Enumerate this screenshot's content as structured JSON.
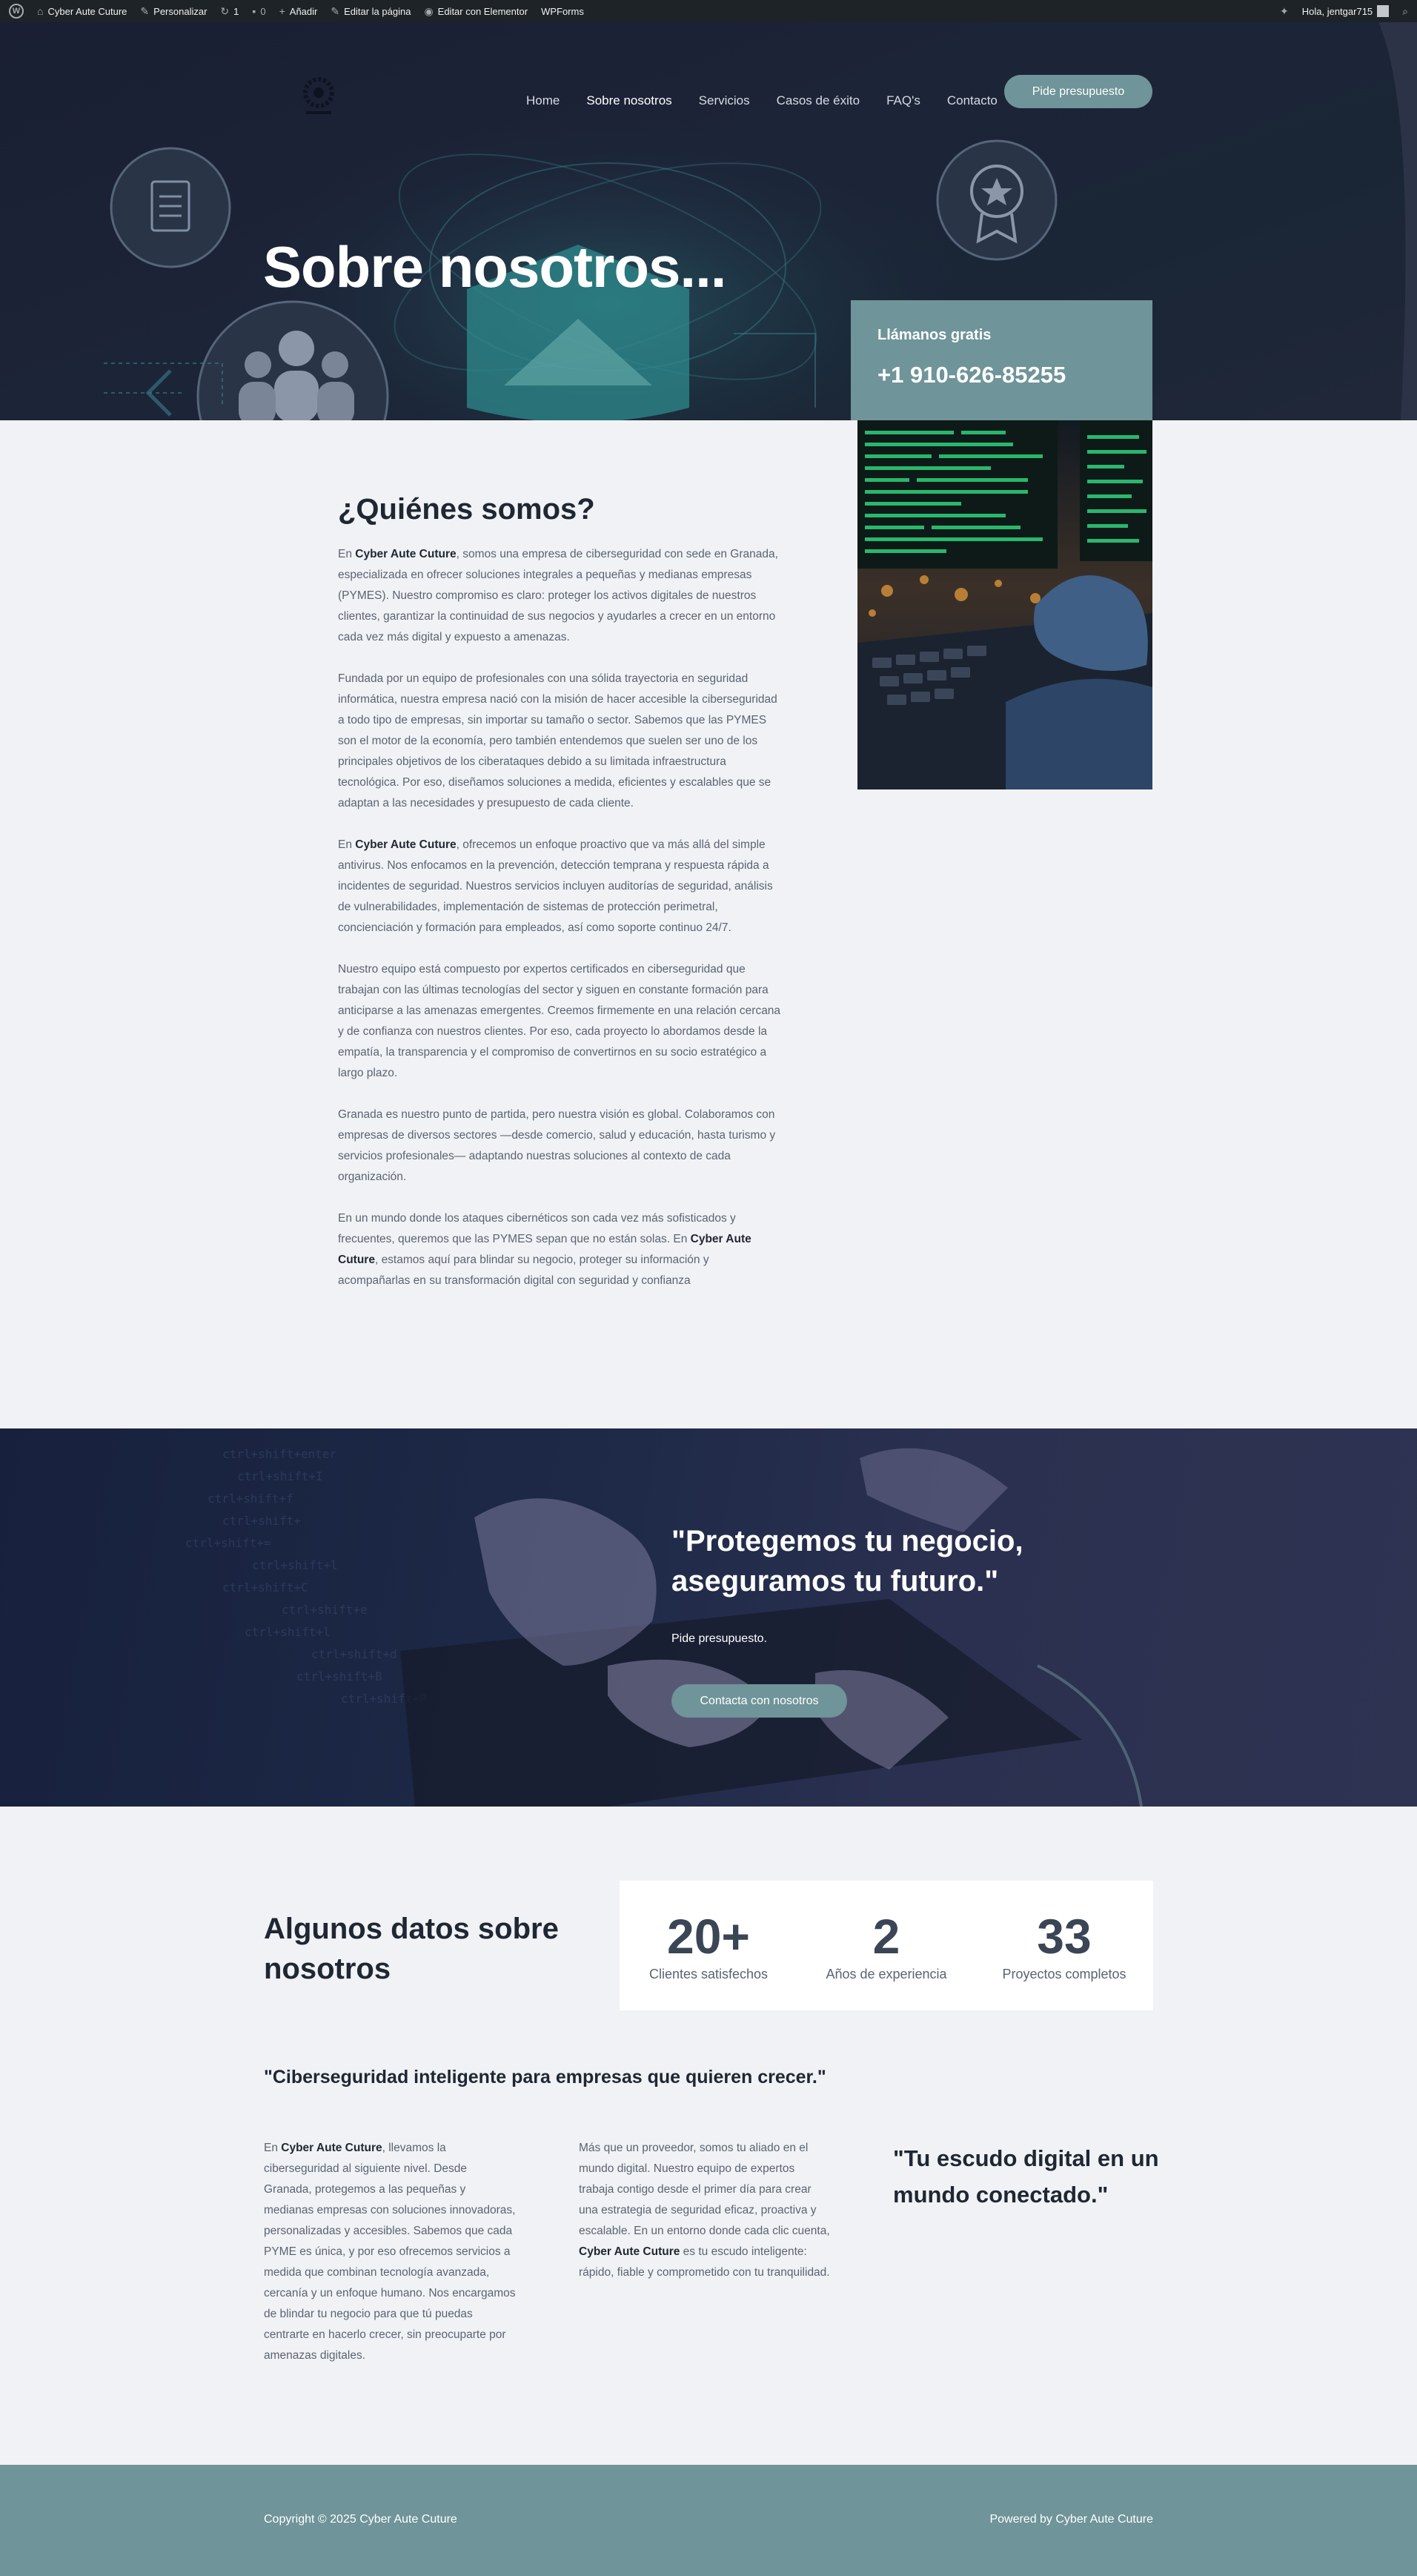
{
  "adminbar": {
    "site_name": "Cyber Aute Cuture",
    "customize": "Personalizar",
    "updates_count": "1",
    "comments_count": "0",
    "add_new": "Añadir",
    "edit_page": "Editar la página",
    "edit_elementor": "Editar con Elementor",
    "wpforms": "WPForms",
    "greeting": "Hola, jentgar715"
  },
  "nav": {
    "items": [
      "Home",
      "Sobre nosotros",
      "Servicios",
      "Casos de éxito",
      "FAQ's",
      "Contacto"
    ],
    "active": "Sobre nosotros",
    "cta": "Pide presupuesto"
  },
  "hero": {
    "title": "Sobre nosotros...",
    "call_label": "Llámanos gratis",
    "phone": "+1 910-626-85255"
  },
  "about": {
    "heading": "¿Quiénes somos?",
    "brand": "Cyber Aute Cuture",
    "p1_a": "En ",
    "p1_b": ", somos una empresa de ciberseguridad con sede en Granada, especializada en ofrecer soluciones integrales a pequeñas y medianas empresas (PYMES). Nuestro compromiso es claro: proteger los activos digitales de nuestros clientes, garantizar la continuidad de sus negocios y ayudarles a crecer en un entorno cada vez más digital y expuesto a amenazas.",
    "p2": "Fundada por un equipo de profesionales con una sólida trayectoria en seguridad informática, nuestra empresa nació con la misión de hacer accesible la ciberseguridad a todo tipo de empresas, sin importar su tamaño o sector. Sabemos que las PYMES son el motor de la economía, pero también entendemos que suelen ser uno de los principales objetivos de los ciberataques debido a su limitada infraestructura tecnológica. Por eso, diseñamos soluciones a medida, eficientes y escalables que se adaptan a las necesidades y presupuesto de cada cliente.",
    "p3_a": "En ",
    "p3_b": ", ofrecemos un enfoque proactivo que va más allá del simple antivirus. Nos enfocamos en la prevención, detección temprana y respuesta rápida a incidentes de seguridad. Nuestros servicios incluyen auditorías de seguridad, análisis de vulnerabilidades, implementación de sistemas de protección perimetral, concienciación y formación para empleados, así como soporte continuo 24/7.",
    "p4": "Nuestro equipo está compuesto por expertos certificados en ciberseguridad que trabajan con las últimas tecnologías del sector y siguen en constante formación para anticiparse a las amenazas emergentes. Creemos firmemente en una relación cercana y de confianza con nuestros clientes. Por eso, cada proyecto lo abordamos desde la empatía, la transparencia y el compromiso de convertirnos en su socio estratégico a largo plazo.",
    "p5": "Granada es nuestro punto de partida, pero nuestra visión es global. Colaboramos con empresas de diversos sectores —desde comercio, salud y educación, hasta turismo y servicios profesionales— adaptando nuestras soluciones al contexto de cada organización.",
    "p6_a": "En un mundo donde los ataques cibernéticos son cada vez más sofisticados y frecuentes, queremos que las PYMES sepan que no están solas. En ",
    "p6_b": ", estamos aquí para blindar su negocio, proteger su información y acompañarlas en su transformación digital con seguridad y confianza"
  },
  "banner": {
    "quote": "\"Protegemos tu negocio, aseguramos tu futuro.\"",
    "sub": "Pide presupuesto.",
    "button": "Contacta con nosotros"
  },
  "stats": {
    "title": "Algunos datos sobre nosotros",
    "items": [
      {
        "num": "20+",
        "caption": "Clientes satisfechos"
      },
      {
        "num": "2",
        "caption": "Años de experiencia"
      },
      {
        "num": "33",
        "caption": "Proyectos completos"
      }
    ]
  },
  "closing": {
    "slogan": "\"Ciberseguridad inteligente para empresas que quieren crecer.\"",
    "col1_a": "En ",
    "col1_b": ", llevamos la ciberseguridad al siguiente nivel. Desde Granada, protegemos a las pequeñas y medianas empresas con soluciones innovadoras, personalizadas y accesibles. Sabemos que cada PYME es única, y por eso ofrecemos servicios a medida que combinan tecnología avanzada, cercanía y un enfoque humano. Nos encargamos de blindar tu negocio para que tú puedas centrarte en hacerlo crecer, sin preocuparte por amenazas digitales.",
    "col2_a": "Más que un proveedor, somos tu aliado en el mundo digital. Nuestro equipo de expertos trabaja contigo desde el primer día para crear una estrategia de seguridad eficaz, proactiva y escalable. En un entorno donde cada clic cuenta, ",
    "col2_b": " es tu escudo inteligente: rápido, fiable y comprometido con tu tranquilidad.",
    "quote": "\"Tu escudo digital en un mundo conectado.\""
  },
  "footer": {
    "copyright": "Copyright © 2025 Cyber Aute Cuture",
    "powered": "Powered by Cyber Aute Cuture"
  },
  "colors": {
    "accent": "#6f9499",
    "page_bg": "#f1f2f5",
    "heading": "#1f2733",
    "body_text": "#5a6472",
    "adminbar": "#1d2327"
  }
}
